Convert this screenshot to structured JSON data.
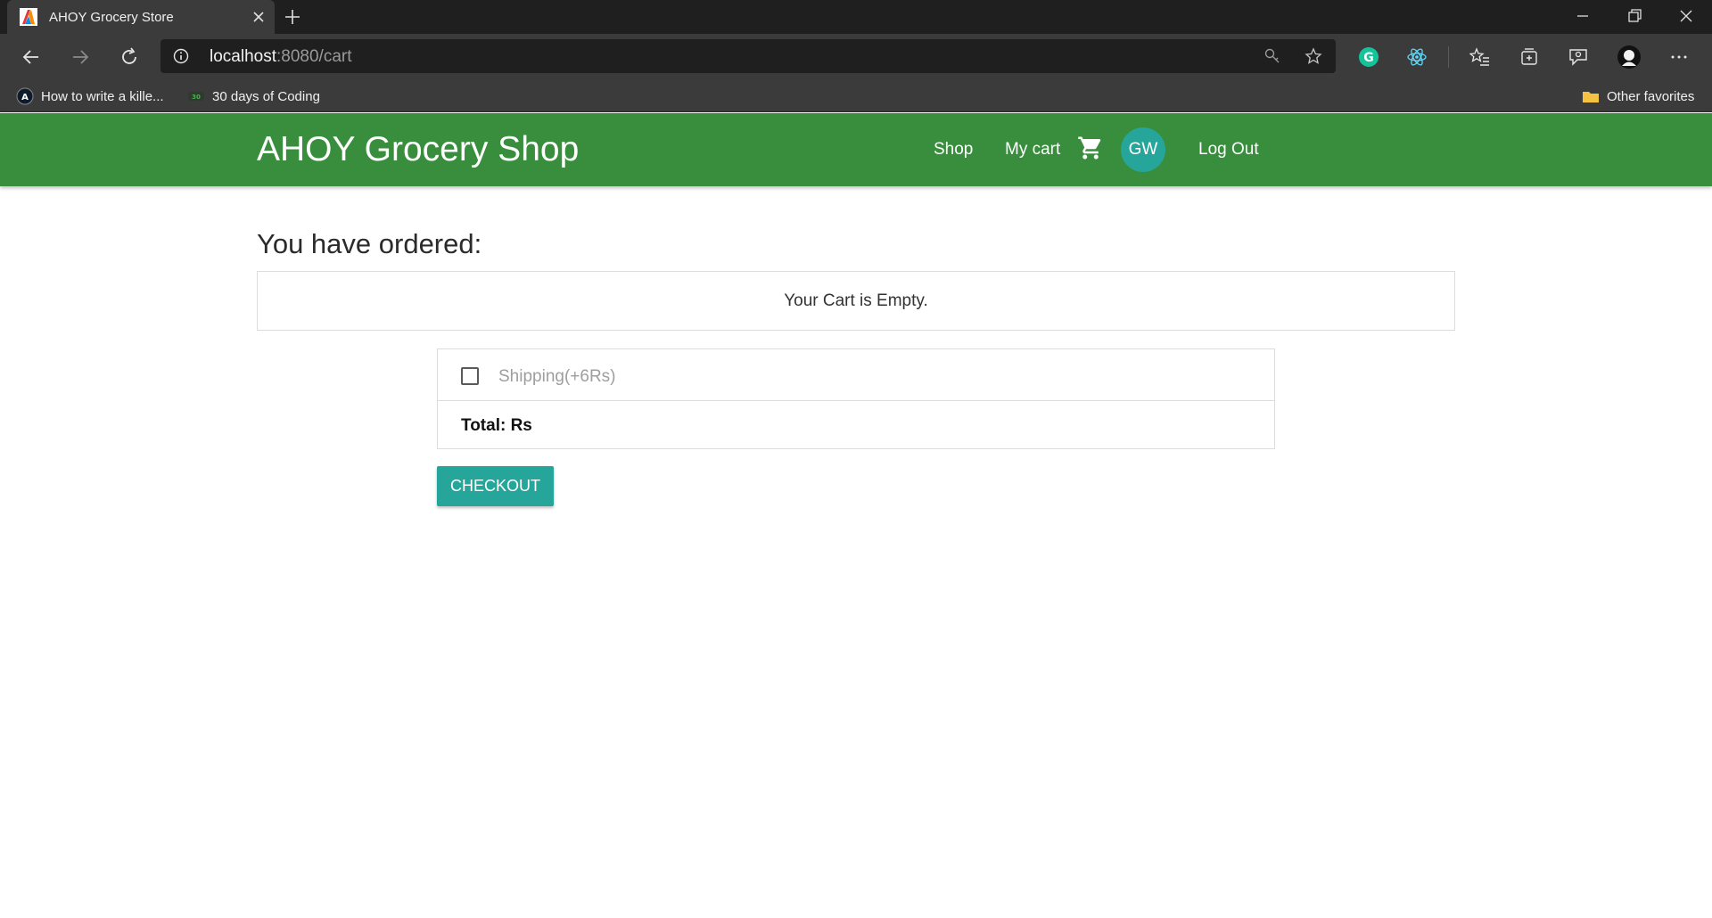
{
  "browser": {
    "tab_title": "AHOY Grocery Store",
    "url_host": "localhost",
    "url_rest": ":8080/cart",
    "icons": {
      "back": "back-arrow-icon",
      "forward": "forward-arrow-icon",
      "reload": "reload-icon",
      "info": "info-icon",
      "key": "key-icon",
      "favorite": "star-icon"
    },
    "extensions": [
      "grammarly-icon",
      "react-devtools-icon",
      "favorites-list-icon",
      "collections-icon",
      "feedback-icon",
      "profile-icon",
      "more-icon"
    ],
    "bookmarks": [
      {
        "label": "How to write a kille...",
        "icon": "bookmark-a-icon"
      },
      {
        "label": "30 days of Coding",
        "icon": "bookmark-30-icon"
      }
    ],
    "other_favorites": "Other favorites"
  },
  "app": {
    "brand": "AHOY Grocery Shop",
    "nav": {
      "shop": "Shop",
      "my_cart": "My cart",
      "avatar_initials": "GW",
      "logout": "Log Out"
    },
    "heading": "You have ordered:",
    "empty_message": "Your Cart is Empty.",
    "shipping_label": "Shipping(+6Rs)",
    "shipping_checked": false,
    "total_label": "Total: Rs",
    "checkout_label": "CHECKOUT"
  },
  "colors": {
    "navbar": "#388e3c",
    "accent": "#26a69a"
  }
}
